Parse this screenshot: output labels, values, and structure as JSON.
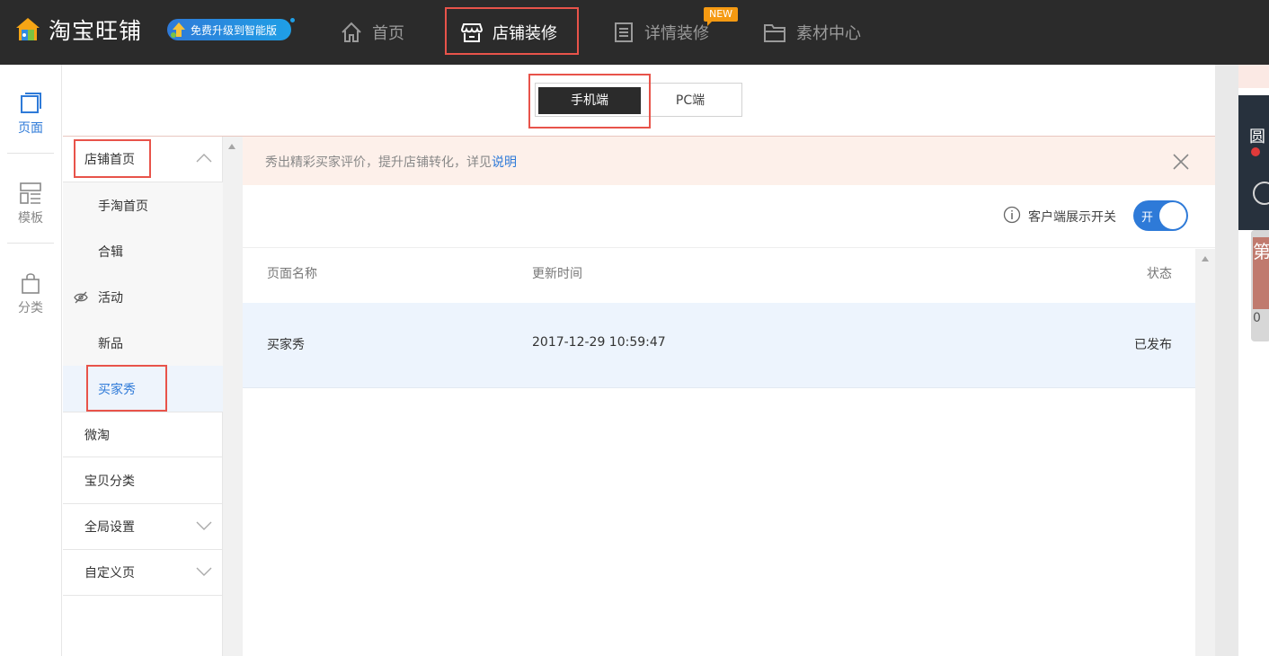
{
  "brand": {
    "name": "淘宝旺铺",
    "upgrade_label": "免费升级到智能版"
  },
  "nav": {
    "items": [
      {
        "label": "首页",
        "icon": "home-icon"
      },
      {
        "label": "店铺装修",
        "icon": "store-icon",
        "active": true
      },
      {
        "label": "详情装修",
        "icon": "list-icon",
        "badge": "NEW"
      },
      {
        "label": "素材中心",
        "icon": "folder-icon"
      }
    ]
  },
  "rail": {
    "items": [
      {
        "label": "页面",
        "icon": "page-icon",
        "active": true
      },
      {
        "label": "模板",
        "icon": "template-icon"
      },
      {
        "label": "分类",
        "icon": "bag-icon"
      }
    ]
  },
  "device": {
    "mobile_label": "手机端",
    "pc_label": "PC端",
    "selected": "mobile"
  },
  "submenu": {
    "shop_home": "店铺首页",
    "children": [
      "手淘首页",
      "合辑",
      "活动",
      "新品",
      "买家秀"
    ],
    "selected_child": "买家秀",
    "groups": [
      "微淘",
      "宝贝分类",
      "全局设置",
      "自定义页"
    ]
  },
  "notice": {
    "text": "秀出精彩买家评价，提升店铺转化，详见",
    "link": "说明"
  },
  "client_toggle": {
    "label": "客户端展示开关",
    "state_text": "开",
    "on": true
  },
  "table": {
    "headers": {
      "name": "页面名称",
      "updated": "更新时间",
      "status": "状态"
    },
    "rows": [
      {
        "name": "买家秀",
        "updated": "2017-12-29 10:59:47",
        "status": "已发布"
      }
    ]
  },
  "preview": {
    "title_char": "圆",
    "card_char": "第",
    "digit": "0"
  },
  "colors": {
    "topbar": "#2b2b2b",
    "accent": "#2e7ad8",
    "highlight": "#e8534a",
    "notice_bg": "#fdf0ea",
    "new_badge": "#f59a12"
  }
}
